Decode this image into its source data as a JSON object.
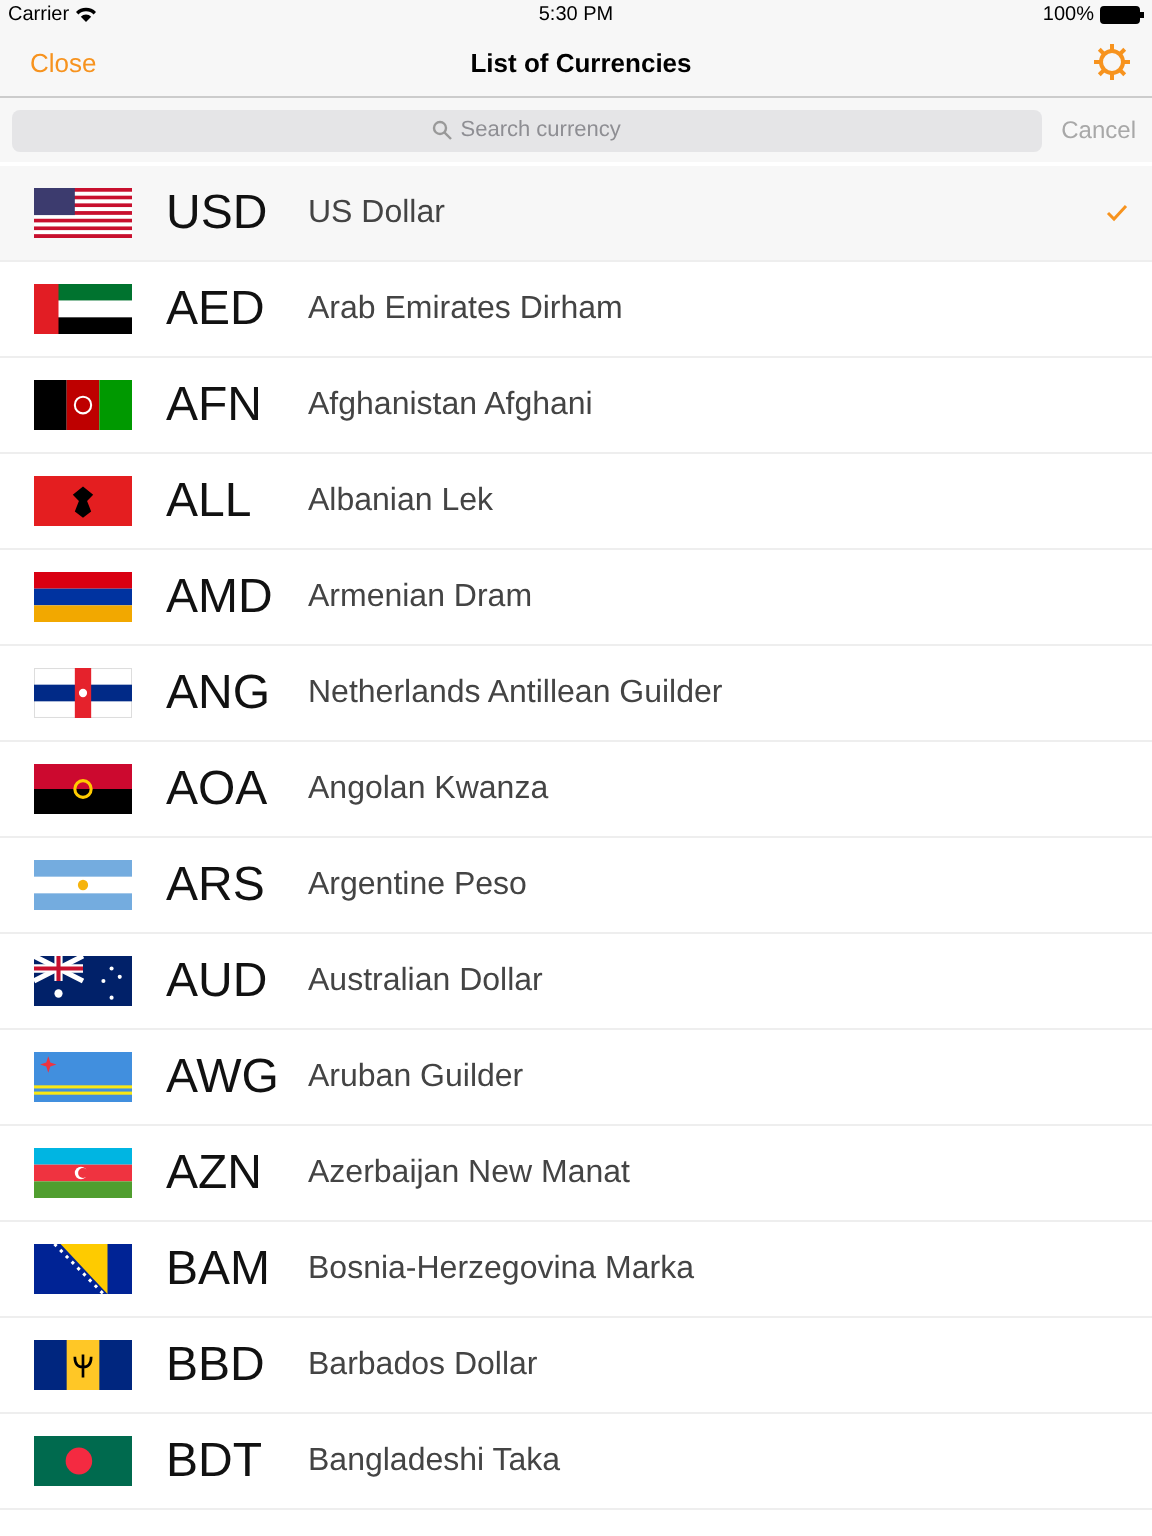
{
  "status_bar": {
    "carrier": "Carrier",
    "time": "5:30 PM",
    "battery": "100%"
  },
  "nav_bar": {
    "left_button": "Close",
    "title": "List of Currencies"
  },
  "search": {
    "placeholder": "Search currency",
    "cancel": "Cancel",
    "cancel_disabled": true
  },
  "currencies": [
    {
      "code": "USD",
      "name": "US Dollar",
      "selected": true
    },
    {
      "code": "AED",
      "name": "Arab Emirates Dirham",
      "selected": false
    },
    {
      "code": "AFN",
      "name": "Afghanistan Afghani",
      "selected": false
    },
    {
      "code": "ALL",
      "name": "Albanian Lek",
      "selected": false
    },
    {
      "code": "AMD",
      "name": "Armenian Dram",
      "selected": false
    },
    {
      "code": "ANG",
      "name": "Netherlands Antillean Guilder",
      "selected": false
    },
    {
      "code": "AOA",
      "name": "Angolan Kwanza",
      "selected": false
    },
    {
      "code": "ARS",
      "name": "Argentine Peso",
      "selected": false
    },
    {
      "code": "AUD",
      "name": "Australian Dollar",
      "selected": false
    },
    {
      "code": "AWG",
      "name": "Aruban Guilder",
      "selected": false
    },
    {
      "code": "AZN",
      "name": "Azerbaijan New Manat",
      "selected": false
    },
    {
      "code": "BAM",
      "name": "Bosnia-Herzegovina Marka",
      "selected": false
    },
    {
      "code": "BBD",
      "name": "Barbados Dollar",
      "selected": false
    },
    {
      "code": "BDT",
      "name": "Bangladeshi Taka",
      "selected": false
    }
  ]
}
